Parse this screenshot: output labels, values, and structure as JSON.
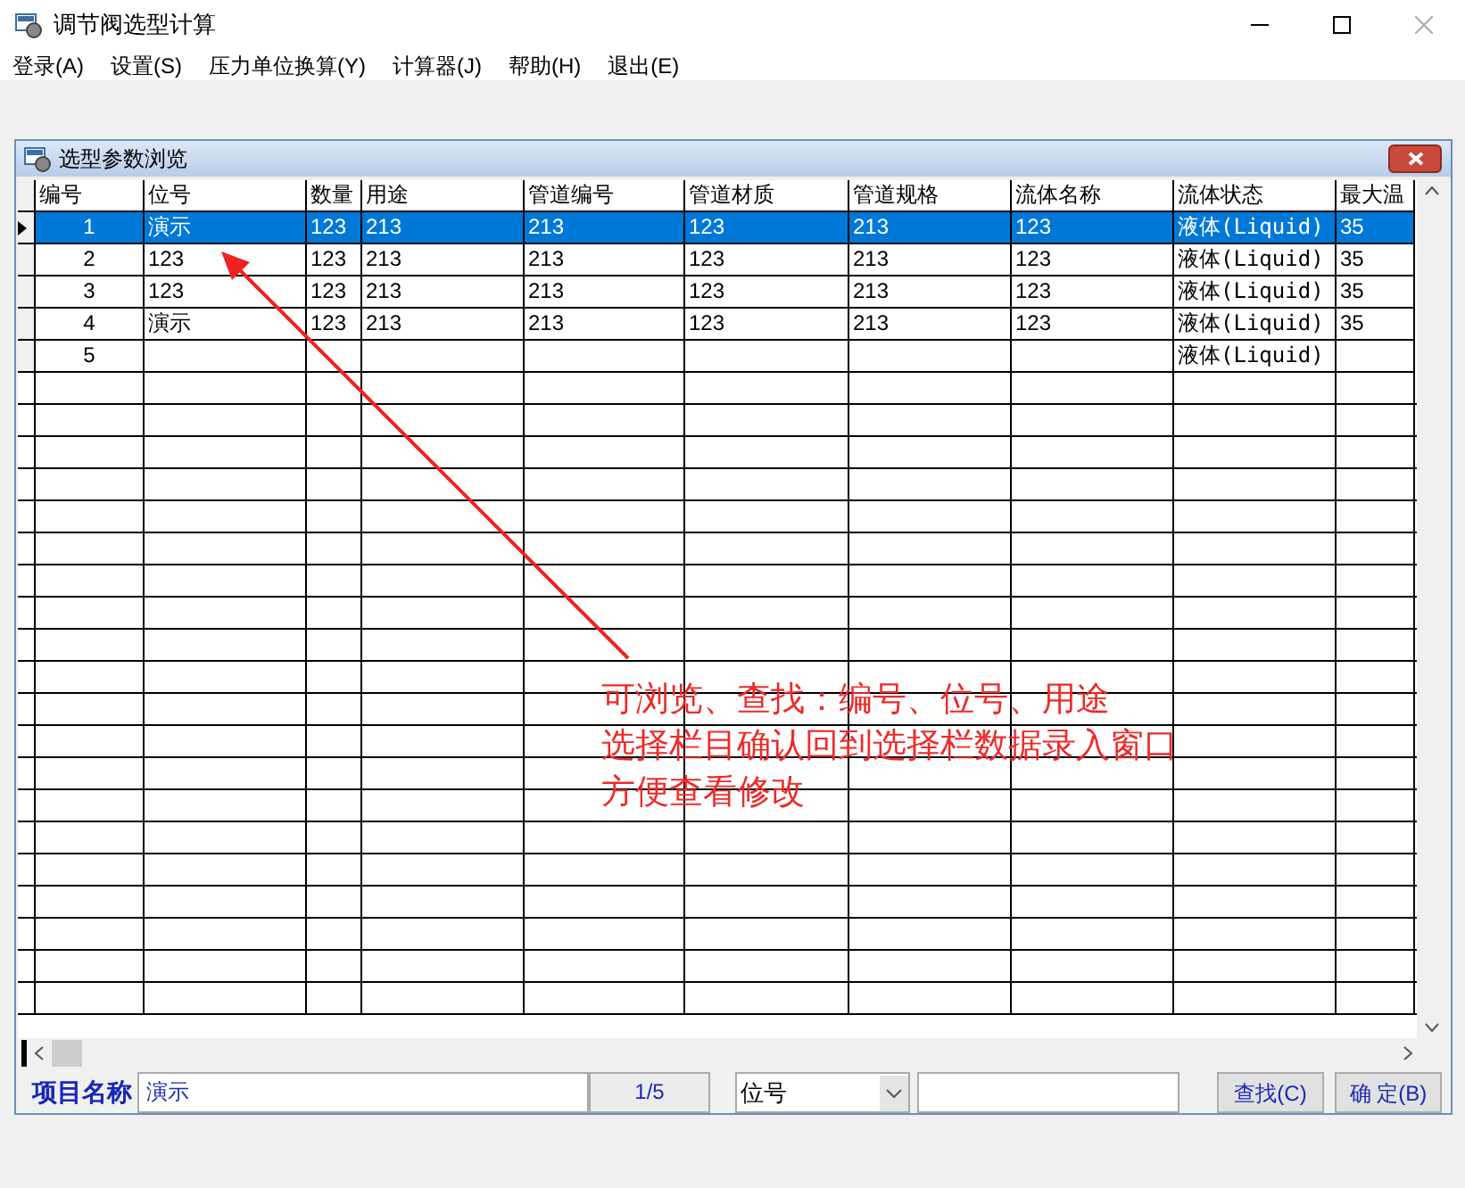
{
  "window": {
    "title": "调节阀选型计算"
  },
  "menu": [
    "登录(A)",
    "设置(S)",
    "压力单位换算(Y)",
    "计算器(J)",
    "帮助(H)",
    "退出(E)"
  ],
  "dialog": {
    "title": "选型参数浏览",
    "table": {
      "columns": [
        "编号",
        "位号",
        "数量",
        "用途",
        "管道编号",
        "管道材质",
        "管道规格",
        "流体名称",
        "流体状态",
        "最大温"
      ],
      "rows": [
        {
          "selected": true,
          "cells": [
            "1",
            "演示",
            "123",
            "213",
            "213",
            "123",
            "213",
            "123",
            "液体(Liquid)",
            "35"
          ]
        },
        {
          "selected": false,
          "cells": [
            "2",
            "123",
            "123",
            "213",
            "213",
            "123",
            "213",
            "123",
            "液体(Liquid)",
            "35"
          ]
        },
        {
          "selected": false,
          "cells": [
            "3",
            "123",
            "123",
            "213",
            "213",
            "123",
            "213",
            "123",
            "液体(Liquid)",
            "35"
          ]
        },
        {
          "selected": false,
          "cells": [
            "4",
            "演示",
            "123",
            "213",
            "213",
            "123",
            "213",
            "123",
            "液体(Liquid)",
            "35"
          ]
        },
        {
          "selected": false,
          "cells": [
            "5",
            "",
            "",
            "",
            "",
            "",
            "",
            "",
            "液体(Liquid)",
            ""
          ]
        }
      ]
    },
    "footer": {
      "label": "项目名称",
      "name_value": "演示",
      "counter": "1/5",
      "field_select": "位号",
      "buttons": [
        "查找(C)",
        "确 定(B)"
      ]
    }
  },
  "annotation": {
    "lines": [
      "可浏览、查找：编号、位号、用途",
      "选择栏目确认回到选择栏数据录入窗口",
      "方便查看修改"
    ]
  }
}
